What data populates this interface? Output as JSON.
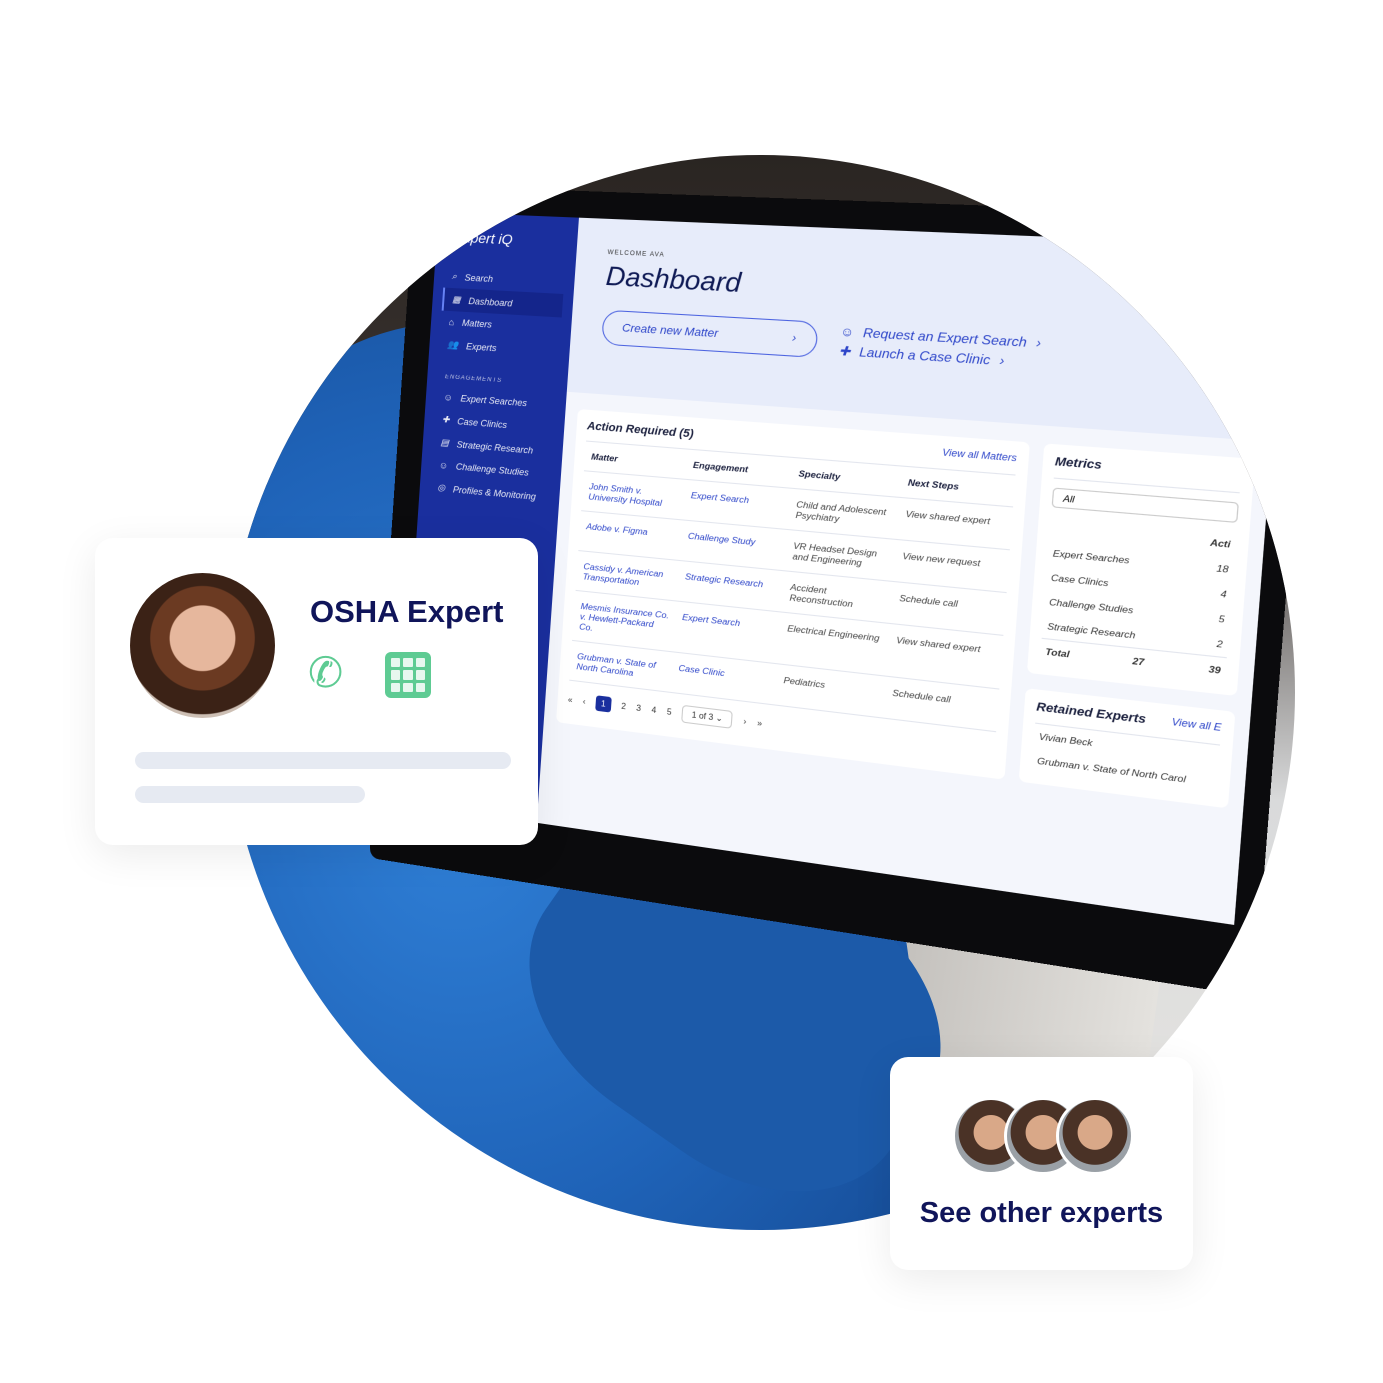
{
  "dashboard": {
    "logo": "Expert iQ",
    "nav": [
      "Search",
      "Dashboard",
      "Matters",
      "Experts"
    ],
    "section": "ENGAGEMENTS",
    "engagements": [
      "Expert Searches",
      "Case Clinics",
      "Strategic Research",
      "Challenge Studies",
      "Profiles & Monitoring"
    ],
    "welcome": "WELCOME AVA",
    "title": "Dashboard",
    "create_matter": "Create new Matter",
    "request_search": "Request an Expert Search",
    "launch_clinic": "Launch a Case Clinic",
    "action_title": "Action Required (5)",
    "view_all_matters": "View all Matters",
    "columns": [
      "Matter",
      "Engagement",
      "Specialty",
      "Next Steps"
    ],
    "rows": [
      [
        "John Smith v. University Hospital",
        "Expert Search",
        "Child and Adolescent Psychiatry",
        "View shared expert"
      ],
      [
        "Adobe v. Figma",
        "Challenge Study",
        "VR Headset Design and Engineering",
        "View new request"
      ],
      [
        "Cassidy v. American Transportation",
        "Strategic Research",
        "Accident Reconstruction",
        "Schedule call"
      ],
      [
        "Mesmis Insurance Co. v. Hewlett-Packard Co.",
        "Expert Search",
        "Electrical Engineering",
        "View shared expert"
      ],
      [
        "Grubman v. State of North Carolina",
        "Case Clinic",
        "Pediatrics",
        "Schedule call"
      ]
    ],
    "pages": [
      "1",
      "2",
      "3",
      "4",
      "5"
    ],
    "page_select": "1 of 3",
    "metrics_title": "Metrics",
    "metrics_filter": "All",
    "metrics_col": "Acti",
    "metrics": [
      [
        "Expert Searches",
        "18"
      ],
      [
        "Case Clinics",
        "4"
      ],
      [
        "Challenge Studies",
        "5"
      ],
      [
        "Strategic Research",
        "2"
      ]
    ],
    "total_label": "Total",
    "total": "27",
    "total2": "39",
    "retained_title": "Retained Experts",
    "view_all_experts": "View all E",
    "retained_name": "Vivian Beck",
    "retained_matter": "Grubman v. State of North Carol"
  },
  "osha_card": {
    "title": "OSHA Expert"
  },
  "others_card": {
    "title": "See other experts"
  },
  "colors": {
    "brand": "#1a2f9e",
    "accent_green": "#5ecb93",
    "heading": "#10155a"
  }
}
